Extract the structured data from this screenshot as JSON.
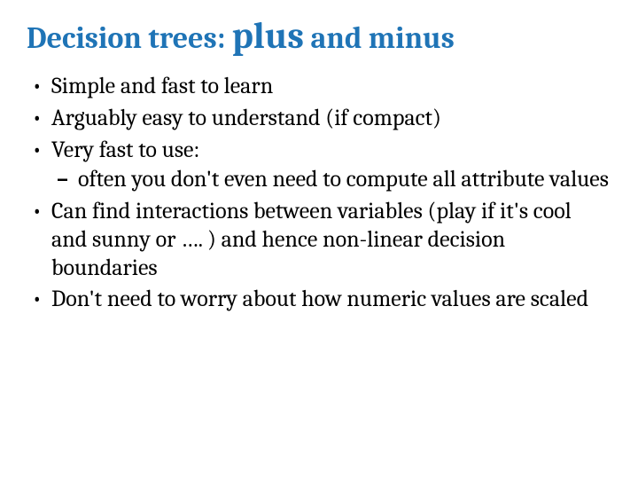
{
  "title": {
    "pre": "Decision trees: ",
    "big": "plus",
    "post": " and minus"
  },
  "bullets": {
    "b1": "Simple and fast to learn",
    "b2": "Arguably easy to understand (if compact)",
    "b3": "Very fast to use:",
    "b3_sub": "often you don't even need to compute all attribute values",
    "b4": "Can find interactions between variables (play if it's cool and sunny or …. ) and hence non-linear decision boundaries",
    "b5": "Don't need to worry about how numeric values are scaled"
  }
}
